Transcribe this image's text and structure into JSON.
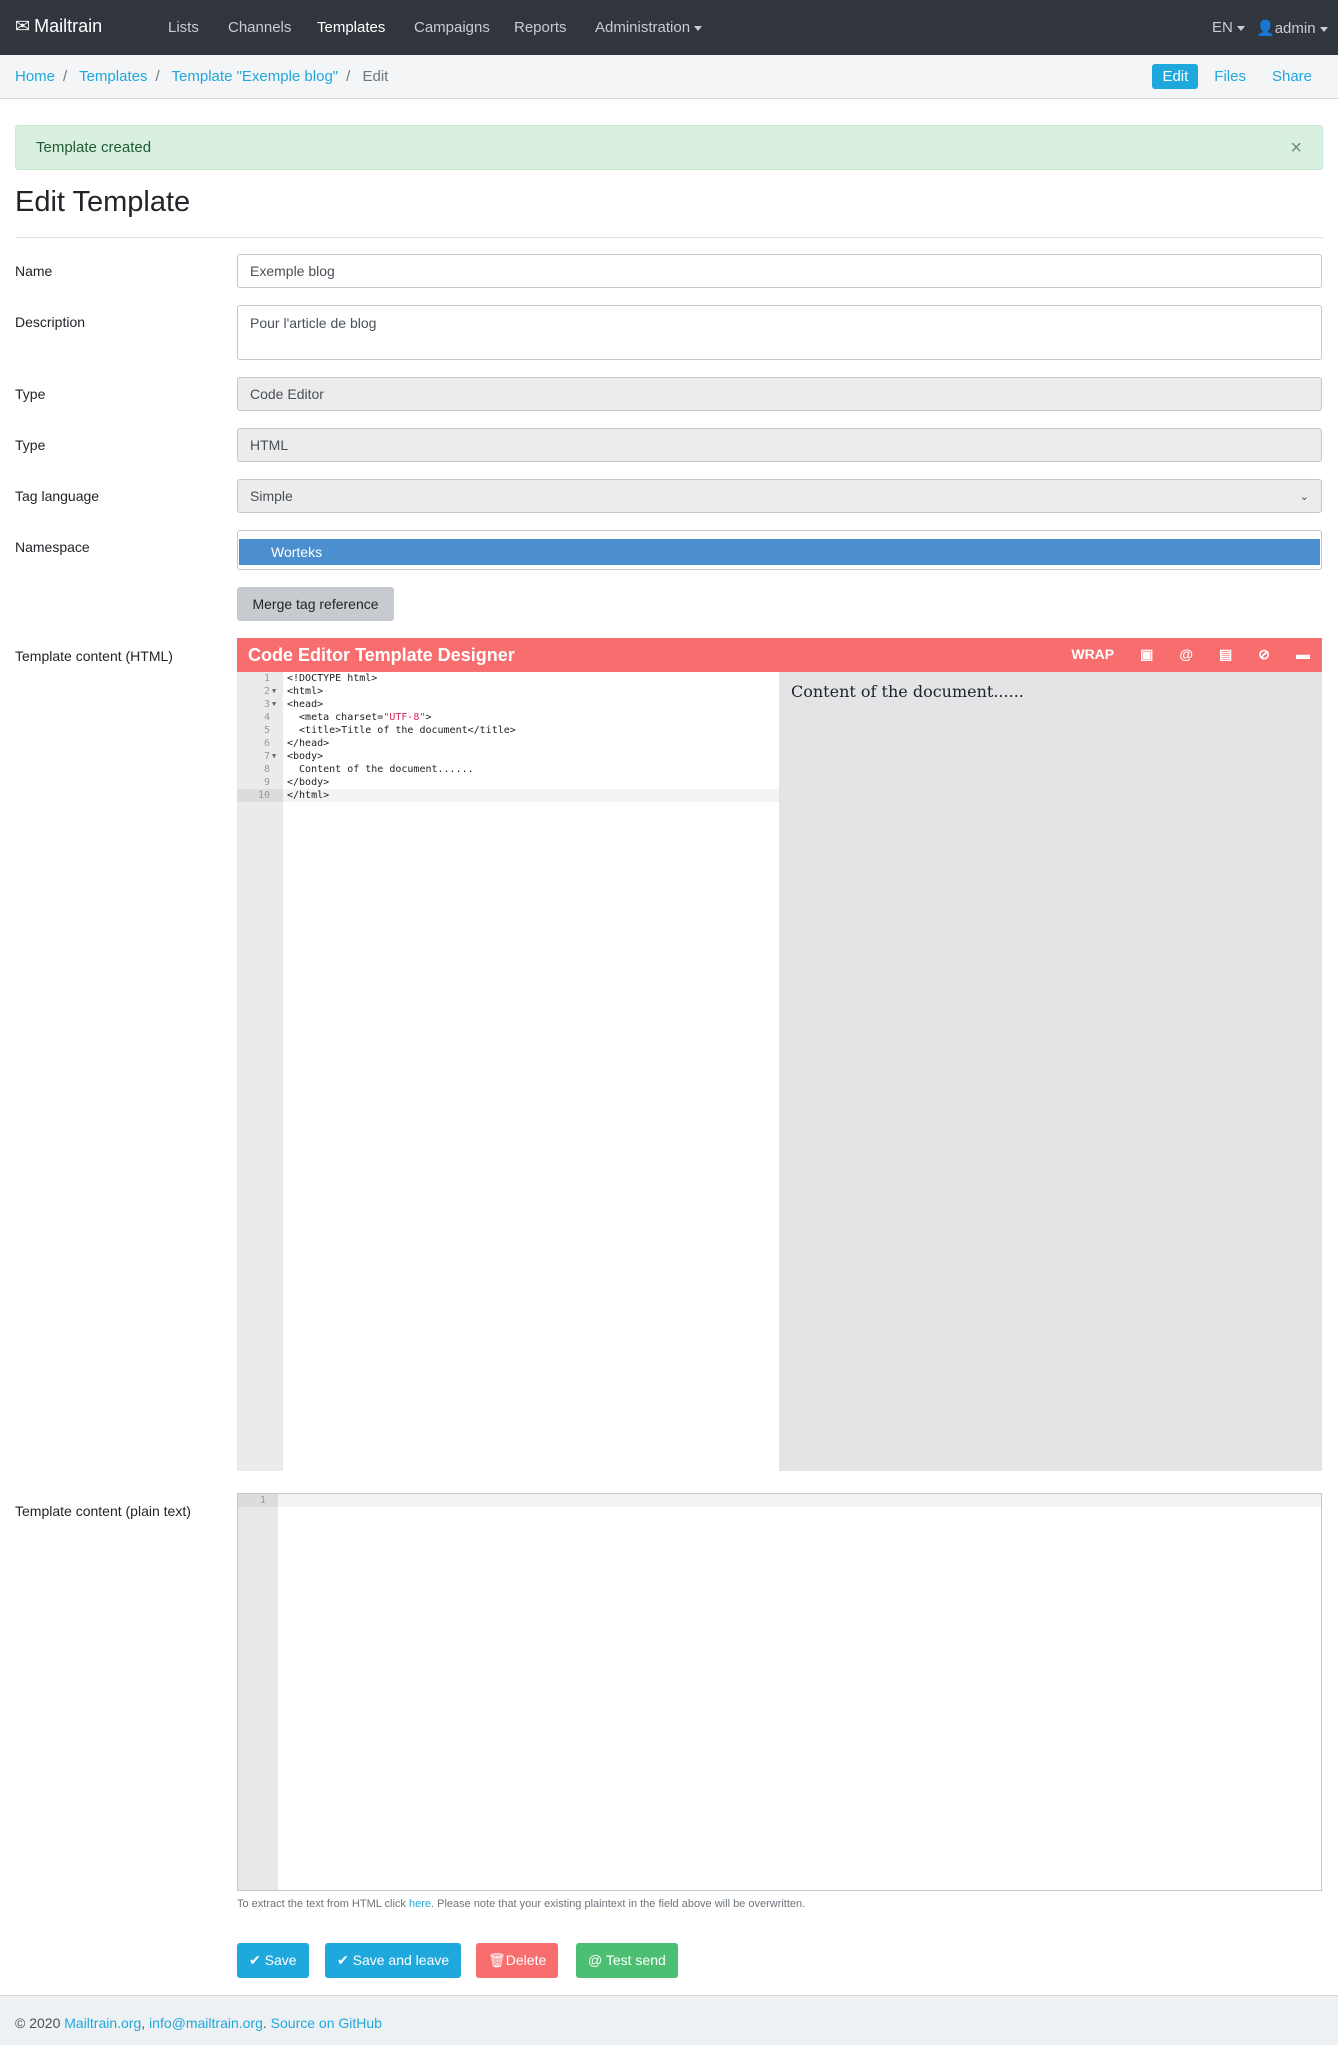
{
  "nav": {
    "brand": "Mailtrain",
    "items": [
      "Lists",
      "Channels",
      "Templates",
      "Campaigns",
      "Reports",
      "Administration"
    ],
    "active": "Templates",
    "lang": "EN",
    "user": "admin"
  },
  "breadcrumb": {
    "items": [
      "Home",
      "Templates",
      "Template \"Exemple blog\""
    ],
    "current": "Edit"
  },
  "tabs": [
    "Edit",
    "Files",
    "Share"
  ],
  "alert": {
    "text": "Template created",
    "close": "×"
  },
  "page_title": "Edit Template",
  "form": {
    "name": {
      "label": "Name",
      "value": "Exemple blog"
    },
    "description": {
      "label": "Description",
      "value": "Pour l'article de blog"
    },
    "type1": {
      "label": "Type",
      "value": "Code Editor"
    },
    "type2": {
      "label": "Type",
      "value": "HTML"
    },
    "tag_language": {
      "label": "Tag language",
      "value": "Simple"
    },
    "namespace": {
      "label": "Namespace",
      "value": "Worteks"
    },
    "merge_button": "Merge tag reference",
    "content_html_label": "Template content (HTML)",
    "content_plain_label": "Template content (plain text)"
  },
  "editor": {
    "title": "Code Editor Template Designer",
    "wrap": "WRAP",
    "accent": "#f86e6e",
    "lines": [
      "<!DOCTYPE html>",
      "<html>",
      "<head>",
      "  <meta charset=\"UTF-8\">",
      "  <title>Title of the document</title>",
      "</head>",
      "<body>",
      "  Content of the document......",
      "</body>",
      "</html>"
    ],
    "preview": "Content of the document......"
  },
  "plain_line": "1",
  "help": {
    "before": "To extract the text from HTML click ",
    "link": "here",
    "after": ". Please note that your existing plaintext in the field above will be overwritten."
  },
  "actions": {
    "save": "Save",
    "save_leave": "Save and leave",
    "delete": "Delete",
    "test": "Test send"
  },
  "footer": {
    "copy": "© 2020 ",
    "link1": "Mailtrain.org",
    "link2": "info@mailtrain.org",
    "link3": "Source on GitHub"
  }
}
